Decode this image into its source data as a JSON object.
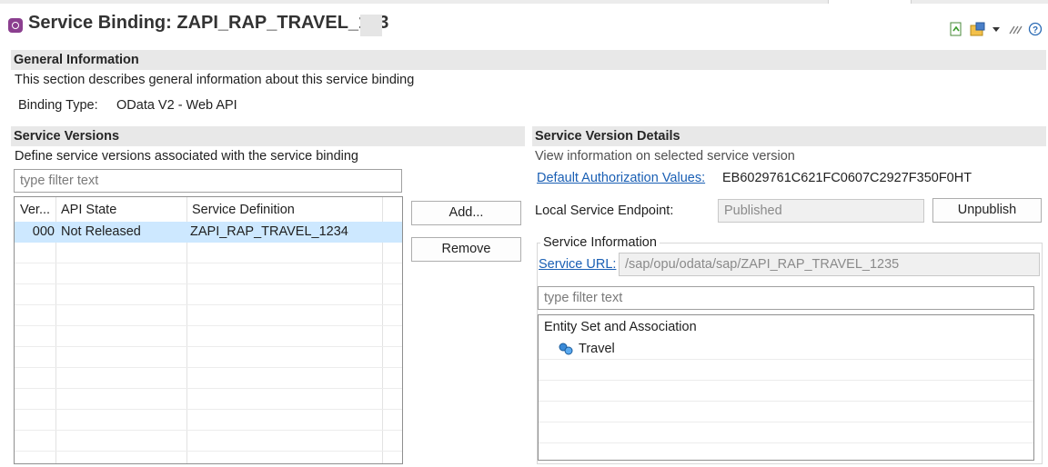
{
  "editor": {
    "title": "Service Binding: ZAPI_RAP_TRAVEL_123"
  },
  "toolbar": {
    "icons": [
      "export-icon",
      "publish-icon",
      "dropdown-icon",
      "pin-icon",
      "help-icon"
    ]
  },
  "general": {
    "header": "General Information",
    "description": "This section describes general information about this service binding",
    "binding_type_label": "Binding Type:",
    "binding_type_value": "OData V2 - Web API"
  },
  "versions": {
    "header": "Service Versions",
    "description": "Define service versions associated with the service binding",
    "filter_placeholder": "type filter text",
    "columns": [
      "Ver...",
      "API State",
      "Service Definition"
    ],
    "rows": [
      {
        "version": "000",
        "state": "Not Released",
        "definition": "ZAPI_RAP_TRAVEL_1234"
      }
    ],
    "add_label": "Add...",
    "remove_label": "Remove"
  },
  "details": {
    "header": "Service Version Details",
    "description": "View information on selected service version",
    "auth_link": "Default Authorization Values:",
    "auth_value": "EB6029761C621FC0607C2927F350F0HT",
    "endpoint_label": "Local Service Endpoint:",
    "endpoint_value": "Published",
    "unpublish_label": "Unpublish",
    "info_group": "Service Information",
    "service_url_link": "Service URL:",
    "service_url_value": "/sap/opu/odata/sap/ZAPI_RAP_TRAVEL_1235",
    "filter_placeholder": "type filter text",
    "tree_root": "Entity Set and Association",
    "tree_items": [
      "Travel"
    ]
  },
  "colors": {
    "selection": "#cde8ff",
    "link": "#1a5fb4",
    "section_header_bg": "#e8e8e8"
  }
}
